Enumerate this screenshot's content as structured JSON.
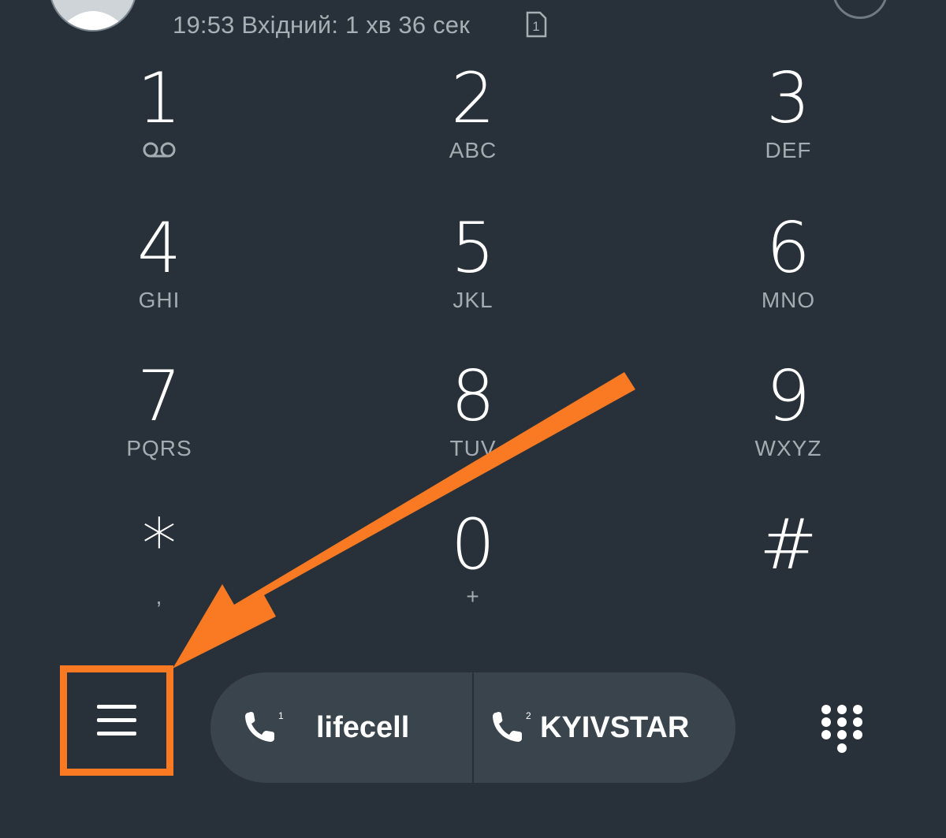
{
  "call_log": {
    "time_type_duration": "19:53 Вхідний: 1 хв 36 сек",
    "sim_slot": "1"
  },
  "keypad": {
    "keys": [
      {
        "digit": "1",
        "letters": ""
      },
      {
        "digit": "2",
        "letters": "ABC"
      },
      {
        "digit": "3",
        "letters": "DEF"
      },
      {
        "digit": "4",
        "letters": "GHI"
      },
      {
        "digit": "5",
        "letters": "JKL"
      },
      {
        "digit": "6",
        "letters": "MNO"
      },
      {
        "digit": "7",
        "letters": "PQRS"
      },
      {
        "digit": "8",
        "letters": "TUV"
      },
      {
        "digit": "9",
        "letters": "WXYZ"
      },
      {
        "digit": "*",
        "letters": ","
      },
      {
        "digit": "0",
        "letters": "+"
      },
      {
        "digit": "#",
        "letters": ""
      }
    ]
  },
  "bottom_bar": {
    "sim1": {
      "slot": "1",
      "label": "lifecell"
    },
    "sim2": {
      "slot": "2",
      "label": "KYIVSTAR"
    }
  },
  "colors": {
    "background": "#283139",
    "accent_highlight": "#f97a22",
    "pill": "#3a444c",
    "muted_text": "#a4acb3"
  }
}
